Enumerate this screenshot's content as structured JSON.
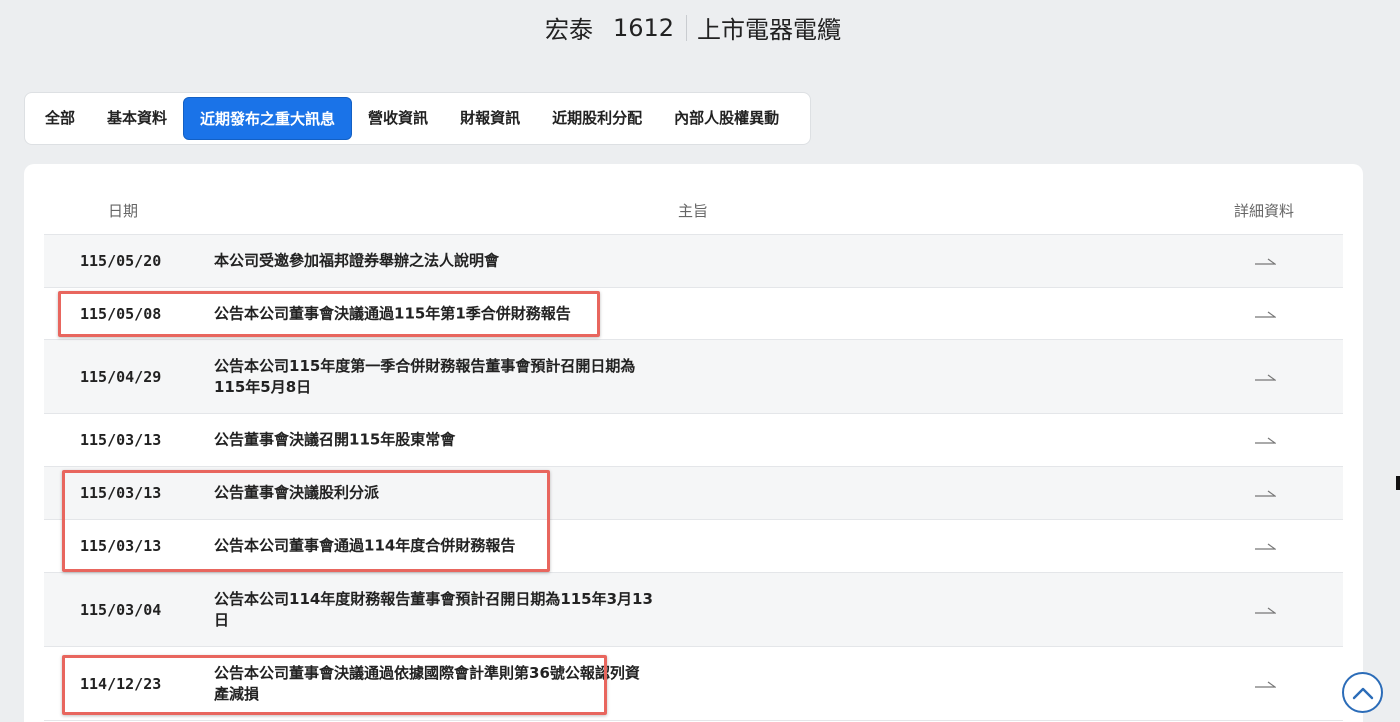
{
  "header": {
    "company_name": "宏泰",
    "stock_code": "1612",
    "category": "上市電器電纜"
  },
  "tabs": [
    {
      "label": "全部",
      "active": false
    },
    {
      "label": "基本資料",
      "active": false
    },
    {
      "label": "近期發布之重大訊息",
      "active": true
    },
    {
      "label": "營收資訊",
      "active": false
    },
    {
      "label": "財報資訊",
      "active": false
    },
    {
      "label": "近期股利分配",
      "active": false
    },
    {
      "label": "內部人股權異動",
      "active": false
    }
  ],
  "table": {
    "columns": [
      "日期",
      "主旨",
      "詳細資料"
    ],
    "rows": [
      {
        "date": "115/05/20",
        "subject": "本公司受邀參加福邦證券舉辦之法人說明會",
        "highlighted": false
      },
      {
        "date": "115/05/08",
        "subject": "公告本公司董事會決議通過115年第1季合併財務報告",
        "highlighted": true
      },
      {
        "date": "115/04/29",
        "subject": "公告本公司115年度第一季合併財務報告董事會預計召開日期為115年5月8日",
        "highlighted": false
      },
      {
        "date": "115/03/13",
        "subject": "公告董事會決議召開115年股東常會",
        "highlighted": false
      },
      {
        "date": "115/03/13",
        "subject": "公告董事會決議股利分派",
        "highlighted": true
      },
      {
        "date": "115/03/13",
        "subject": "公告本公司董事會通過114年度合併財務報告",
        "highlighted": true
      },
      {
        "date": "115/03/04",
        "subject": "公告本公司114年度財務報告董事會預計召開日期為115年3月13日",
        "highlighted": false
      },
      {
        "date": "114/12/23",
        "subject": "公告本公司董事會決議通過依據國際會計準則第36號公報認列資產減損",
        "highlighted": true
      }
    ]
  },
  "icons": {
    "detail": "arrow-right-icon",
    "back_to_top": "chevron-up-icon"
  },
  "colors": {
    "accent": "#1a73e8",
    "highlight_border": "#e8665e",
    "background": "#eceef0"
  }
}
